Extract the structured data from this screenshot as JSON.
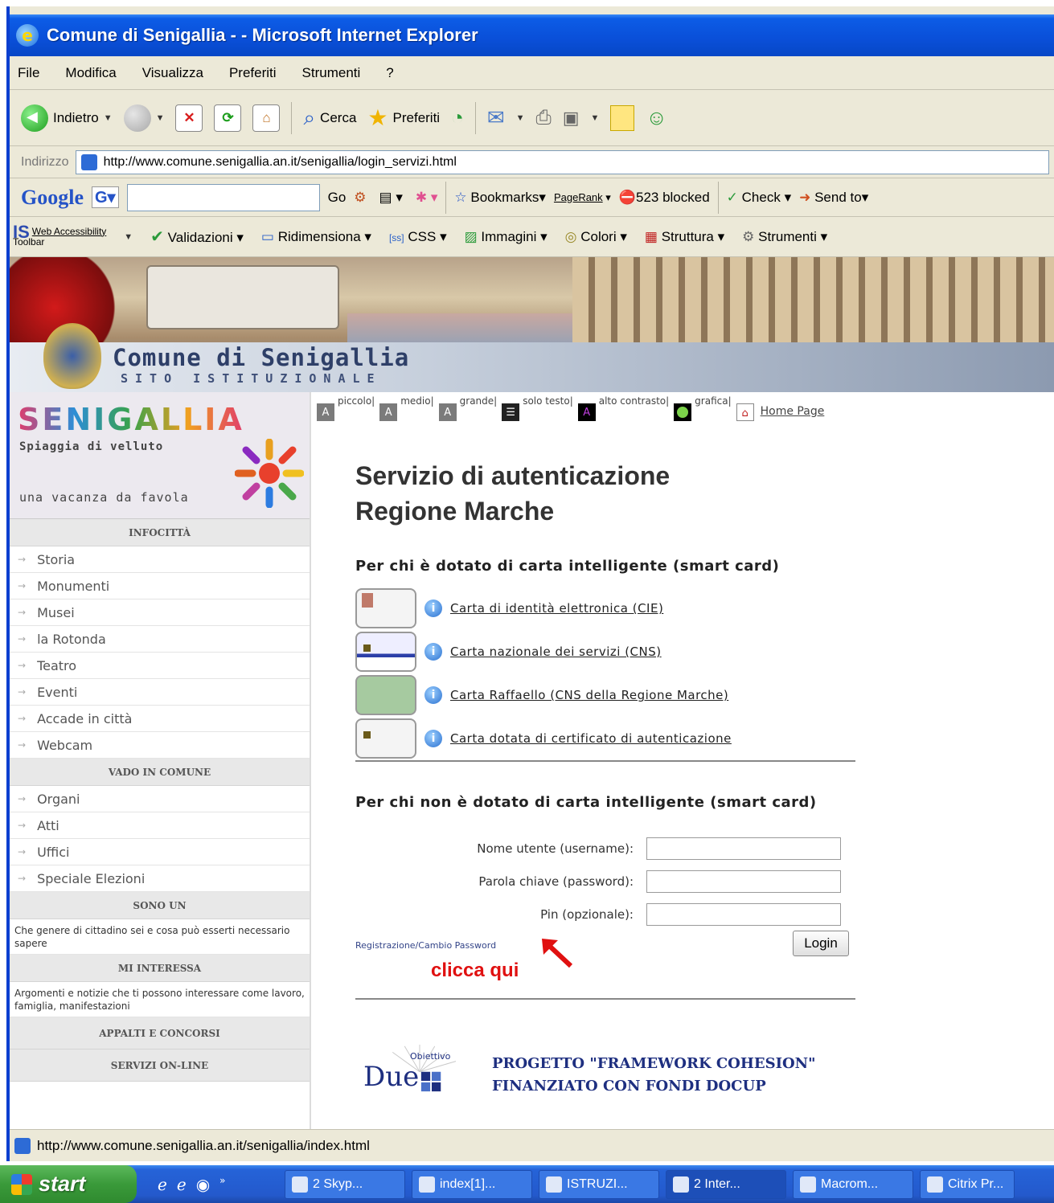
{
  "window": {
    "title": "Comune di Senigallia - - Microsoft Internet Explorer"
  },
  "menu": [
    "File",
    "Modifica",
    "Visualizza",
    "Preferiti",
    "Strumenti",
    "?"
  ],
  "toolbar": {
    "back": "Indietro",
    "search": "Cerca",
    "favorites": "Preferiti"
  },
  "address": {
    "label": "Indirizzo",
    "url": "http://www.comune.senigallia.an.it/senigallia/login_servizi.html"
  },
  "google_bar": {
    "logo": "Google",
    "go": "Go",
    "bookmarks": "Bookmarks",
    "pagerank": "PageRank",
    "blocked": "523 blocked",
    "check": "Check",
    "send_to": "Send to"
  },
  "wat_bar": {
    "logo_line1": "Web Accessibility",
    "logo_line2": "Toolbar",
    "items": [
      "Validazioni",
      "Ridimensiona",
      "CSS",
      "Immagini",
      "Colori",
      "Struttura",
      "Strumenti"
    ]
  },
  "banner": {
    "title": "Comune di Senigallia",
    "subtitle": "SITO ISTITUZIONALE"
  },
  "promo": {
    "brand": "SENIGALLIA",
    "tagline": "Spiaggia di velluto",
    "slogan": "una vacanza da favola"
  },
  "sidebar": {
    "infocitta": {
      "title": "INFOCITTÀ",
      "items": [
        "Storia",
        "Monumenti",
        "Musei",
        "la Rotonda",
        "Teatro",
        "Eventi",
        "Accade in città",
        "Webcam"
      ]
    },
    "vado": {
      "title": "VADO IN COMUNE",
      "items": [
        "Organi",
        "Atti",
        "Uffici",
        "Speciale Elezioni"
      ]
    },
    "sono_un": {
      "title": "SONO UN",
      "desc": "Che genere di cittadino sei e cosa può esserti necessario sapere"
    },
    "mi_interessa": {
      "title": "MI INTERESSA",
      "desc": "Argomenti e notizie che ti possono interessare come lavoro, famiglia, manifestazioni"
    },
    "appalti": {
      "title": "APPALTI E CONCORSI"
    },
    "servizi": {
      "title": "SERVIZI ON-LINE"
    }
  },
  "accessibility": {
    "options": [
      "piccolo",
      "medio",
      "grande",
      "solo testo",
      "alto contrasto",
      "grafica"
    ],
    "home": "Home Page"
  },
  "main": {
    "title_line1": "Servizio di autenticazione",
    "title_line2": "Regione Marche",
    "smartcard_heading": "Per chi è dotato di carta intelligente (smart card)",
    "cards": [
      "Carta di identità elettronica (CIE)",
      "Carta nazionale dei servizi (CNS)",
      "Carta Raffaello (CNS della Regione Marche)",
      "Carta dotata di certificato di autenticazione"
    ],
    "nocard_heading": "Per chi non è dotato di carta intelligente (smart card)",
    "form": {
      "username_label": "Nome utente (username):",
      "password_label": "Parola chiave (password):",
      "pin_label": "Pin (opzionale):",
      "login": "Login",
      "register_link": "Registrazione/Cambio Password",
      "click_here": "clicca qui"
    },
    "footer": {
      "logo_top": "Obiettivo",
      "logo_main": "Due",
      "line1": "PROGETTO \"FRAMEWORK COHESION\"",
      "line2": "FINANZIATO CON FONDI DOCUP"
    }
  },
  "status": {
    "url": "http://www.comune.senigallia.an.it/senigallia/index.html"
  },
  "taskbar": {
    "start": "start",
    "tasks": [
      "2 Skyp...",
      "index[1]...",
      "ISTRUZI...",
      "2 Inter...",
      "Macrom...",
      "Citrix Pr..."
    ]
  }
}
